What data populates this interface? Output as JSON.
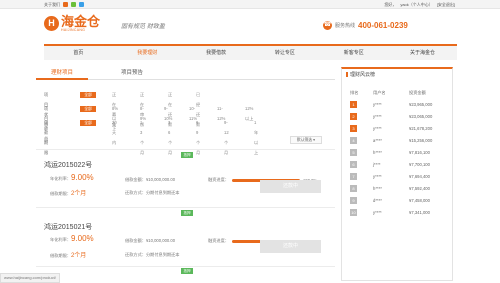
{
  "topbar": {
    "about": "关于我们",
    "user_label": "您好，",
    "user_name": "yaok（个人中心）",
    "logout": "[安全退出]"
  },
  "logo": {
    "cn": "海金仓",
    "en": "HAIJINCANG"
  },
  "slogan": "固有规范  财致盈",
  "hotline": {
    "label": "服务热线",
    "number": "400-061-0239"
  },
  "nav": [
    "首页",
    "我要理财",
    "我要借款",
    "转让专区",
    "新客专区",
    "关于海金仓"
  ],
  "tabs": [
    "理财项目",
    "项目预告"
  ],
  "filters": [
    {
      "label": "项目状态",
      "all": "全部",
      "options": [
        "正在募集",
        "正在审核",
        "正在还款",
        "已经还款"
      ]
    },
    {
      "label": "项目收益",
      "all": "全部",
      "options": [
        "8%以下",
        "8-9%",
        "9-10%",
        "10-11%",
        "11-12%",
        "12%以上"
      ]
    },
    {
      "label": "借款期限",
      "all": "全部",
      "options": [
        "30天内",
        "1-3个月",
        "3-6个月",
        "6-9个月",
        "9-12个月",
        "1年以上"
      ]
    }
  ],
  "sort_button": "默认筛选 ▾",
  "products": [
    {
      "badge": "抵押",
      "title": "鸿运2015022号",
      "rate_label": "年化利率：",
      "rate": "9.00%",
      "term_label": "借款期限：",
      "term": "2个月",
      "amount_label": "借款金额：",
      "amount": "¥10,000,000.00",
      "repay": "还款方式：分期付息到期还本",
      "progress_label": "融资进度：",
      "progress": 100,
      "progress_text": "100.0%",
      "button": "还款中"
    },
    {
      "badge": "抵押",
      "title": "鸿运2015021号",
      "rate_label": "年化利率：",
      "rate": "9.00%",
      "term_label": "借款期限：",
      "term": "2个月",
      "amount_label": "借款金额：",
      "amount": "¥10,000,000.00",
      "repay": "还款方式：分期付息到期还本",
      "progress_label": "融资进度：",
      "progress": 100,
      "progress_text": "100.0%",
      "button": "还款中"
    },
    {
      "badge": "抵押"
    }
  ],
  "rank": {
    "title": "理财风云榜",
    "headers": [
      "排名",
      "用户名",
      "投资金额"
    ],
    "rows": [
      {
        "n": "1",
        "user": "y****",
        "amount": "¥23,965,000"
      },
      {
        "n": "2",
        "user": "y****",
        "amount": "¥23,065,000"
      },
      {
        "n": "3",
        "user": "y****",
        "amount": "¥21,678,200"
      },
      {
        "n": "4",
        "user": "a****",
        "amount": "¥15,256,000"
      },
      {
        "n": "5",
        "user": "h****",
        "amount": "¥7,816,100"
      },
      {
        "n": "6",
        "user": "j****",
        "amount": "¥7,700,100"
      },
      {
        "n": "7",
        "user": "y****",
        "amount": "¥7,694,400"
      },
      {
        "n": "8",
        "user": "h****",
        "amount": "¥7,592,400"
      },
      {
        "n": "9",
        "user": "d****",
        "amount": "¥7,458,000"
      },
      {
        "n": "10",
        "user": "y****",
        "amount": "¥7,341,000"
      }
    ]
  },
  "status_url": "www.haijincang.com/product/"
}
